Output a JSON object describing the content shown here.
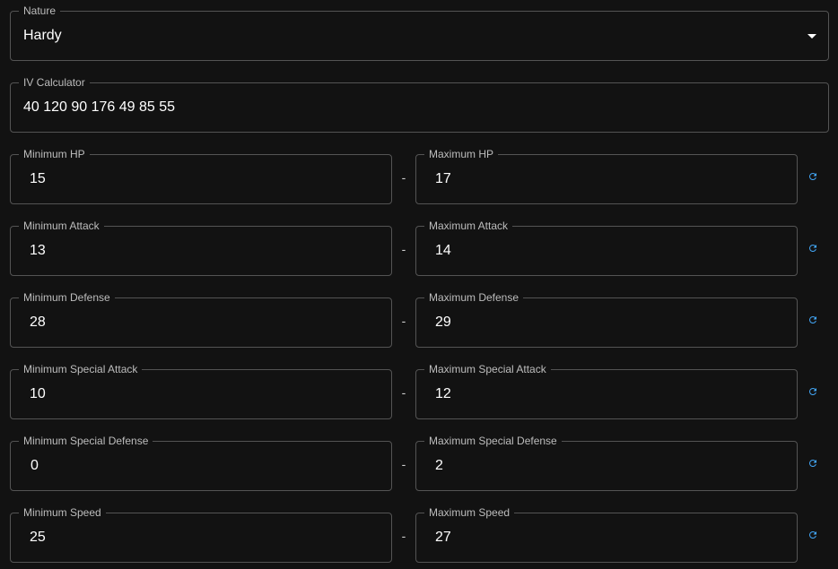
{
  "nature": {
    "label": "Nature",
    "value": "Hardy"
  },
  "iv_calculator": {
    "label": "IV Calculator",
    "value": "40 120 90 176 49 85 55"
  },
  "range_separator": "-",
  "stats": [
    {
      "min_label": "Minimum HP",
      "min_value": "15",
      "max_label": "Maximum HP",
      "max_value": "17"
    },
    {
      "min_label": "Minimum Attack",
      "min_value": "13",
      "max_label": "Maximum Attack",
      "max_value": "14"
    },
    {
      "min_label": "Minimum Defense",
      "min_value": "28",
      "max_label": "Maximum Defense",
      "max_value": "29"
    },
    {
      "min_label": "Minimum Special Attack",
      "min_value": "10",
      "max_label": "Maximum Special Attack",
      "max_value": "12"
    },
    {
      "min_label": "Minimum Special Defense",
      "min_value": "0",
      "max_label": "Maximum Special Defense",
      "max_value": "2"
    },
    {
      "min_label": "Minimum Speed",
      "min_value": "25",
      "max_label": "Maximum Speed",
      "max_value": "27"
    }
  ],
  "colors": {
    "background": "#121212",
    "accent": "#42a5f5"
  },
  "icons": {
    "reset": "refresh-icon",
    "dropdown": "caret-down-icon"
  }
}
